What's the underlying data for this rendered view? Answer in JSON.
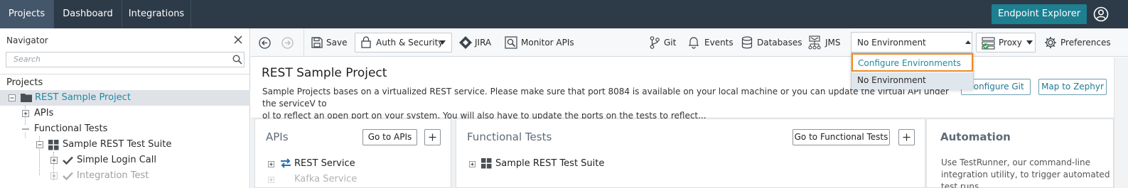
{
  "topnav": {
    "tabs": [
      "Projects",
      "Dashboard",
      "Integrations"
    ],
    "endpoint_explorer": "Endpoint Explorer",
    "user_icon": "user-circle-icon"
  },
  "navigator": {
    "title": "Navigator",
    "search_placeholder": "Search",
    "projects_label": "Projects",
    "tree": [
      "REST Sample Project",
      "APIs",
      "Functional Tests",
      "Sample REST Test Suite",
      "Simple Login Call",
      "Integration Test"
    ]
  },
  "toolbar": {
    "save": "Save",
    "auth_security": "Auth & Security",
    "jira": "JIRA",
    "monitor_apis": "Monitor APIs",
    "git": "Git",
    "events": "Events",
    "databases": "Databases",
    "jms": "JMS",
    "environment": "No Environment",
    "proxy": "Proxy",
    "preferences": "Preferences"
  },
  "env_menu": {
    "options": [
      "Configure Environments",
      "No Environment"
    ],
    "highlight_color": "#f08a24"
  },
  "project": {
    "title": "REST Sample Project",
    "description_line1": "Sample Projects bases on a virtualized REST service. Please make sure that port 8084 is available on your local machine or you can update the virtual API under the serviceV to",
    "description_line2": "ol to reflect an open port on your system. You will also have to update the ports on the tests to reflect...",
    "configure_git": "Configure Git",
    "map_to_zephyr": "Map to Zephyr"
  },
  "panels": {
    "apis": {
      "title": "APIs",
      "go_button": "Go to APIs",
      "items": [
        "REST Service",
        "Kafka Service"
      ]
    },
    "functional_tests": {
      "title": "Functional Tests",
      "go_button": "Go to Functional Tests",
      "items": [
        "Sample REST Test Suite"
      ]
    },
    "automation": {
      "title": "Automation",
      "text": "Use TestRunner, our command-line integration utility, to trigger automated test runs"
    }
  },
  "colors": {
    "topbar": "#2d3b48",
    "accent": "#1d7f90",
    "link": "#1f8aa3"
  }
}
